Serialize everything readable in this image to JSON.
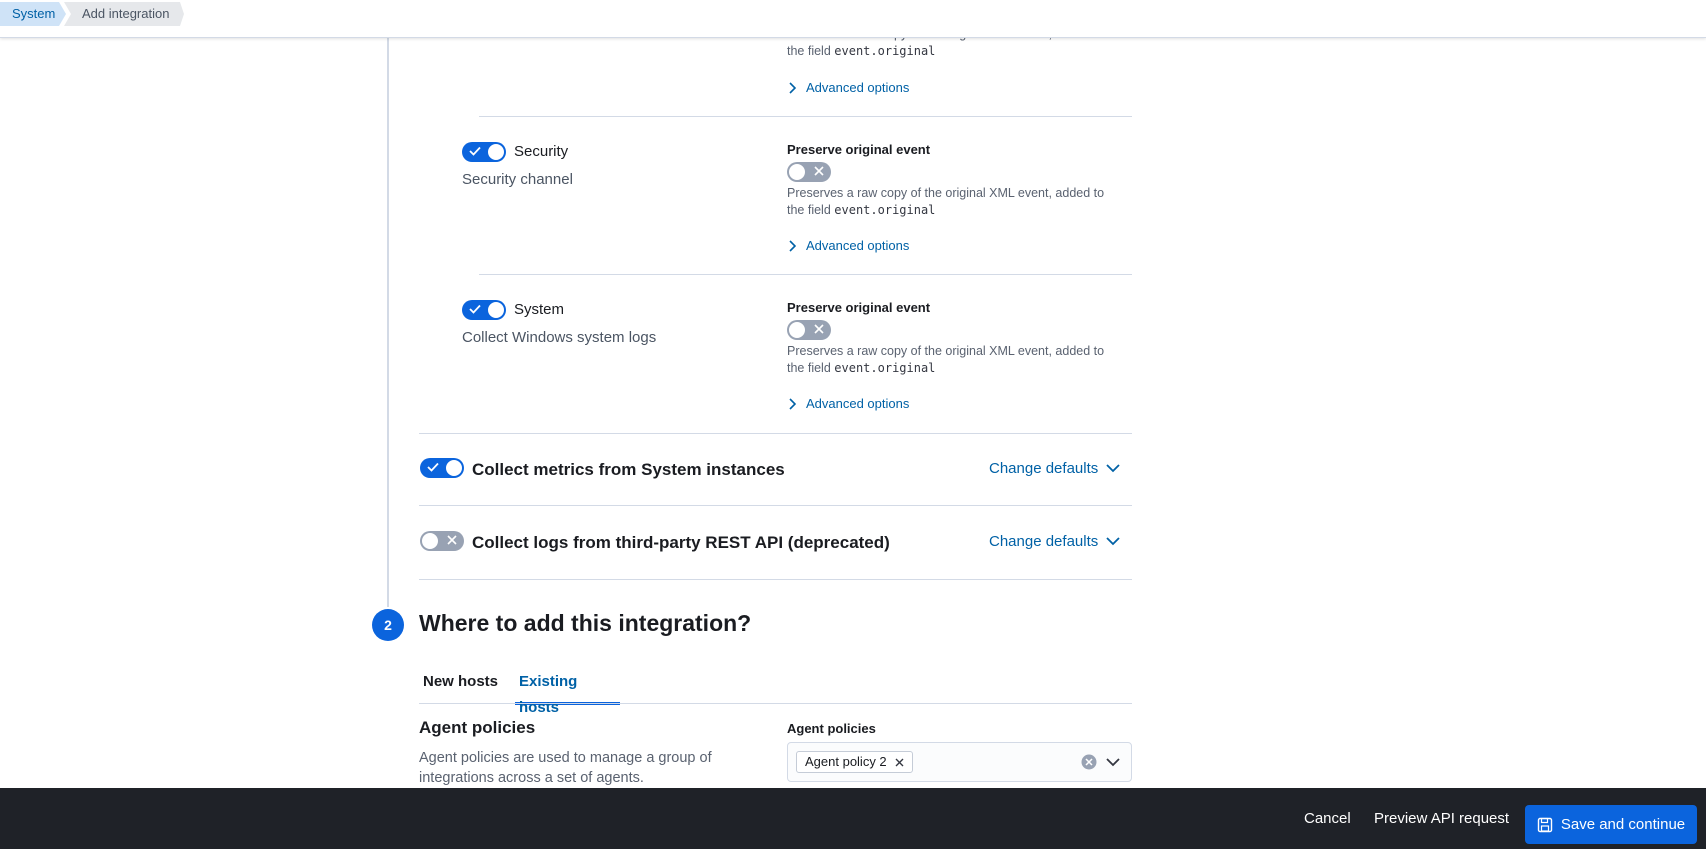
{
  "breadcrumbs": [
    "System",
    "Add integration"
  ],
  "top_stream": {
    "help_prefix": "Preserves a raw copy of the original XML event, added to",
    "help_field_prefix": "the field",
    "help_field": "event.original",
    "advanced_label": "Advanced options"
  },
  "streams": [
    {
      "title": "Security",
      "description": "Security channel",
      "enabled": true,
      "preserve_label": "Preserve original event",
      "preserve_enabled": false,
      "help_prefix": "Preserves a raw copy of the original XML event, added to",
      "help_field_prefix": "the field",
      "help_field": "event.original",
      "advanced_label": "Advanced options"
    },
    {
      "title": "System",
      "description": "Collect Windows system logs",
      "enabled": true,
      "preserve_label": "Preserve original event",
      "preserve_enabled": false,
      "help_prefix": "Preserves a raw copy of the original XML event, added to",
      "help_field_prefix": "the field",
      "help_field": "event.original",
      "advanced_label": "Advanced options"
    }
  ],
  "inputs": [
    {
      "title": "Collect metrics from System instances",
      "enabled": true,
      "change_label": "Change defaults"
    },
    {
      "title": "Collect logs from third-party REST API (deprecated)",
      "enabled": false,
      "change_label": "Change defaults"
    }
  ],
  "step": {
    "number": "2",
    "title": "Where to add this integration?",
    "tabs": [
      "New hosts",
      "Existing hosts"
    ],
    "selected_tab": "Existing hosts"
  },
  "agent_policies": {
    "heading": "Agent policies",
    "description": "Agent policies are used to manage a group of integrations across a set of agents.",
    "field_label": "Agent policies",
    "selected": [
      "Agent policy 2"
    ]
  },
  "footer": {
    "cancel": "Cancel",
    "preview": "Preview API request",
    "save": "Save and continue"
  },
  "colors": {
    "accent": "#0b64dd",
    "link": "#0061a6",
    "footer_bg": "#1f2228"
  }
}
